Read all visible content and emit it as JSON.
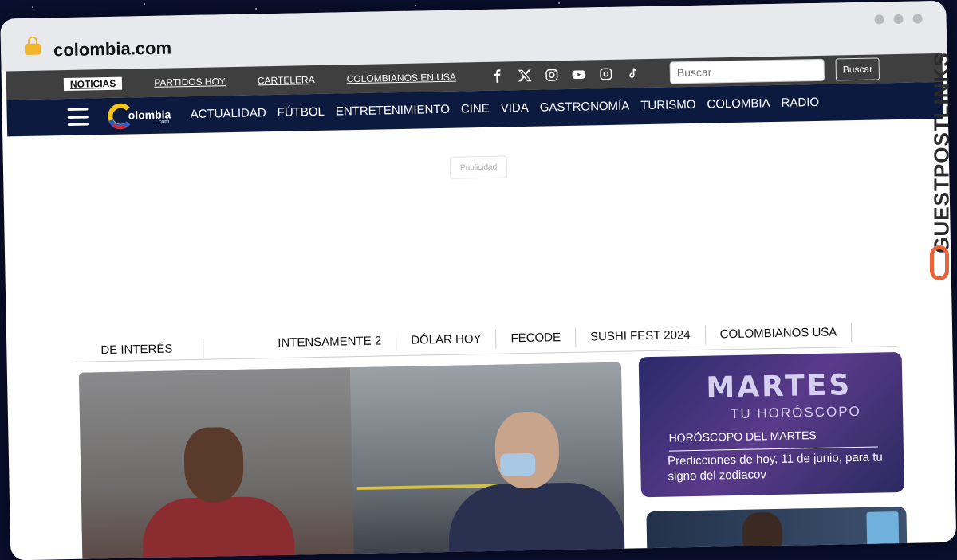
{
  "browser": {
    "url": "colombia.com"
  },
  "topbar": {
    "links": [
      "NOTICIAS",
      "PARTIDOS HOY",
      "CARTELERA",
      "COLOMBIANOS EN USA"
    ],
    "social_icons": [
      "facebook-icon",
      "x-icon",
      "instagram-icon",
      "youtube-icon",
      "threads-icon",
      "tiktok-icon"
    ],
    "search_placeholder": "Buscar",
    "search_button": "Buscar"
  },
  "navbar": {
    "logo_text": "olombia",
    "logo_sub": ".com",
    "links": [
      "ACTUALIDAD",
      "FÚTBOL",
      "ENTRETENIMIENTO",
      "CINE",
      "VIDA",
      "GASTRONOMÍA",
      "TURISMO",
      "COLOMBIA",
      "RADIO"
    ]
  },
  "ad": {
    "label": "Publicidad"
  },
  "tags": {
    "heading": "DE INTERÉS",
    "items": [
      "INTENSAMENTE 2",
      "DÓLAR HOY",
      "FECODE",
      "SUSHI FEST 2024",
      "COLOMBIANOS USA"
    ]
  },
  "side_card": {
    "image_big": "MARTES",
    "image_sub": "TU HORÓSCOPO",
    "kicker": "HORÓSCOPO DEL MARTES",
    "title": "Predicciones de hoy, 11 de junio, para tu signo del zodiacov"
  },
  "watermark": {
    "text": "GUESTPOSTLINKS"
  },
  "colors": {
    "topbar": "#3f3f3f",
    "navbar": "#0c1a40",
    "accent": "#e8643a"
  }
}
